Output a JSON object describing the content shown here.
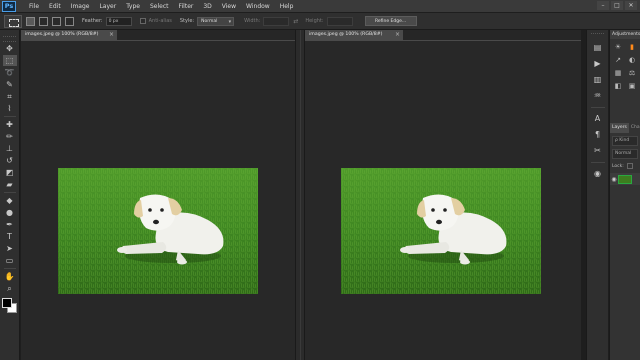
{
  "app": {
    "logo": "Ps"
  },
  "menu": [
    "File",
    "Edit",
    "Image",
    "Layer",
    "Type",
    "Select",
    "Filter",
    "3D",
    "View",
    "Window",
    "Help"
  ],
  "window_controls": {
    "minimize": "–",
    "maximize": "□",
    "close": "✕"
  },
  "options_bar": {
    "feather_label": "Feather:",
    "feather_value": "0 px",
    "antialias_label": "Anti-alias",
    "style_label": "Style:",
    "style_value": "Normal",
    "width_label": "Width:",
    "height_label": "Height:",
    "swap_icon": "⇄",
    "refine_edge_label": "Refine Edge..."
  },
  "toolbar_tools": [
    {
      "name": "move-tool-icon",
      "glyph": "✥"
    },
    {
      "name": "marquee-tool-icon",
      "glyph": "⬚"
    },
    {
      "name": "lasso-tool-icon",
      "glyph": "➰"
    },
    {
      "name": "quick-selection-tool-icon",
      "glyph": "✎"
    },
    {
      "name": "crop-tool-icon",
      "glyph": "⌗"
    },
    {
      "name": "eyedropper-tool-icon",
      "glyph": "⌇"
    },
    {
      "name": "healing-brush-tool-icon",
      "glyph": "✚"
    },
    {
      "name": "brush-tool-icon",
      "glyph": "✏"
    },
    {
      "name": "clone-stamp-tool-icon",
      "glyph": "⊥"
    },
    {
      "name": "history-brush-tool-icon",
      "glyph": "↺"
    },
    {
      "name": "eraser-tool-icon",
      "glyph": "◩"
    },
    {
      "name": "gradient-tool-icon",
      "glyph": "▰"
    },
    {
      "name": "blur-tool-icon",
      "glyph": "◆"
    },
    {
      "name": "dodge-tool-icon",
      "glyph": "●"
    },
    {
      "name": "pen-tool-icon",
      "glyph": "✒"
    },
    {
      "name": "type-tool-icon",
      "glyph": "T"
    },
    {
      "name": "path-selection-tool-icon",
      "glyph": "➤"
    },
    {
      "name": "shape-tool-icon",
      "glyph": "▭"
    },
    {
      "name": "hand-tool-icon",
      "glyph": "✋"
    },
    {
      "name": "zoom-tool-icon",
      "glyph": "⌕"
    }
  ],
  "documents": {
    "left_tab": "images.jpeg @ 100% (RGB/8#)",
    "right_tab": "images.jpeg @ 100% (RGB/8#)",
    "close_glyph": "×"
  },
  "right_dock": [
    {
      "name": "history-icon",
      "glyph": "▤"
    },
    {
      "name": "play-actions-icon",
      "glyph": "▶"
    },
    {
      "name": "layer-comps-icon",
      "glyph": "▥"
    },
    {
      "name": "brush-presets-icon",
      "glyph": "♒"
    },
    {
      "name": "character-icon",
      "glyph": "A"
    },
    {
      "name": "paragraph-icon",
      "glyph": "¶"
    },
    {
      "name": "tools-icon",
      "glyph": "✂"
    },
    {
      "name": "3d-icon",
      "glyph": "◉"
    }
  ],
  "panels": {
    "adjustments_title": "Adjustments",
    "adjust_icons": [
      {
        "name": "brightness-icon",
        "glyph": "☀",
        "orange": false
      },
      {
        "name": "levels-icon",
        "glyph": "▮",
        "orange": true
      },
      {
        "name": "curves-icon",
        "glyph": "↗",
        "orange": false
      },
      {
        "name": "exposure-icon",
        "glyph": "◐",
        "orange": false
      },
      {
        "name": "hue-icon",
        "glyph": "▦",
        "orange": false
      },
      {
        "name": "balance-icon",
        "glyph": "⚖",
        "orange": false
      },
      {
        "name": "bw-icon",
        "glyph": "◧",
        "orange": false
      },
      {
        "name": "photo-filter-icon",
        "glyph": "▣",
        "orange": false
      }
    ],
    "layers_tab": "Layers",
    "channels_tab": "Cha",
    "kind_label": "ρ Kind",
    "blend_label": "Normal",
    "lock_label": "Lock:"
  },
  "colors": {
    "accent": "#4a9ee8",
    "orange": "#ff8a1a",
    "panel_bg": "#333333"
  }
}
